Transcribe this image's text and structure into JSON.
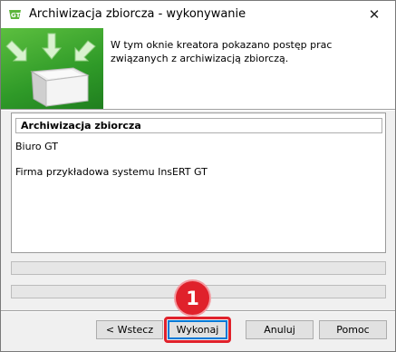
{
  "window": {
    "title": "Archiwizacja zbiorcza - wykonywanie",
    "close_label": "✕",
    "app_icon": "gt-logo-icon"
  },
  "header": {
    "description": "W tym oknie kreatora pokazano postęp prac związanych z archiwizacją zbiorczą.",
    "banner_icon": "archive-box-icon",
    "accent_color": "#3aa52e"
  },
  "list": {
    "header": "Archiwizacja zbiorcza",
    "items": [
      "Biuro GT",
      "Firma przykładowa systemu InsERT GT"
    ]
  },
  "progress": {
    "bar1_fraction": 0,
    "bar2_fraction": 0
  },
  "buttons": {
    "back": "< Wstecz",
    "execute": "Wykonaj",
    "cancel": "Anuluj",
    "help": "Pomoc"
  },
  "annotation": {
    "marker": "1",
    "color": "#e0212b"
  }
}
